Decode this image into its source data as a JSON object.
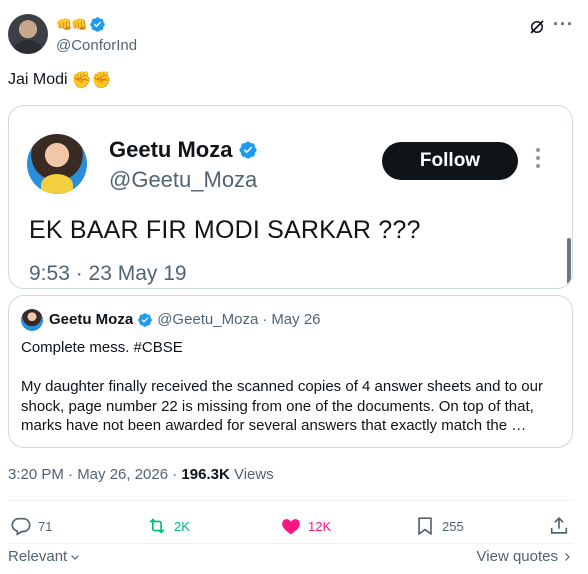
{
  "author": {
    "display_name_emojis": "👊👊",
    "handle": "@ConforInd",
    "avatar_icon": "user-avatar"
  },
  "tweet": {
    "text": "Jai Modi",
    "emojis": "✊✊"
  },
  "embedded_tweet": {
    "name": "Geetu Moza",
    "handle": "@Geetu_Moza",
    "follow_label": "Follow",
    "text": "EK BAAR FIR MODI SARKAR ???",
    "time": "9:53 · 23 May 19"
  },
  "quote_tweet": {
    "name": "Geetu Moza",
    "handle": "@Geetu_Moza",
    "separator": "·",
    "date": "May 26",
    "line1": "Complete mess. #CBSE",
    "line2": "My daughter finally received the scanned copies of 4 answer sheets and to our shock, page number 22 is missing from one of the documents. On top of that, marks have not been awarded for several answers that exactly match the …"
  },
  "meta": {
    "time_date": "3:20 PM · May 26, 2026 · ",
    "views_count": "196.3K",
    "views_label": " Views"
  },
  "actions": {
    "replies": "71",
    "reposts": "2K",
    "likes": "12K",
    "bookmarks": "255"
  },
  "footer": {
    "sort_label": "Relevant",
    "view_quotes_label": "View quotes"
  },
  "colors": {
    "verified": "#1d9bf0",
    "repost": "#00ba7c",
    "like": "#f91880",
    "text_secondary": "#536471"
  }
}
